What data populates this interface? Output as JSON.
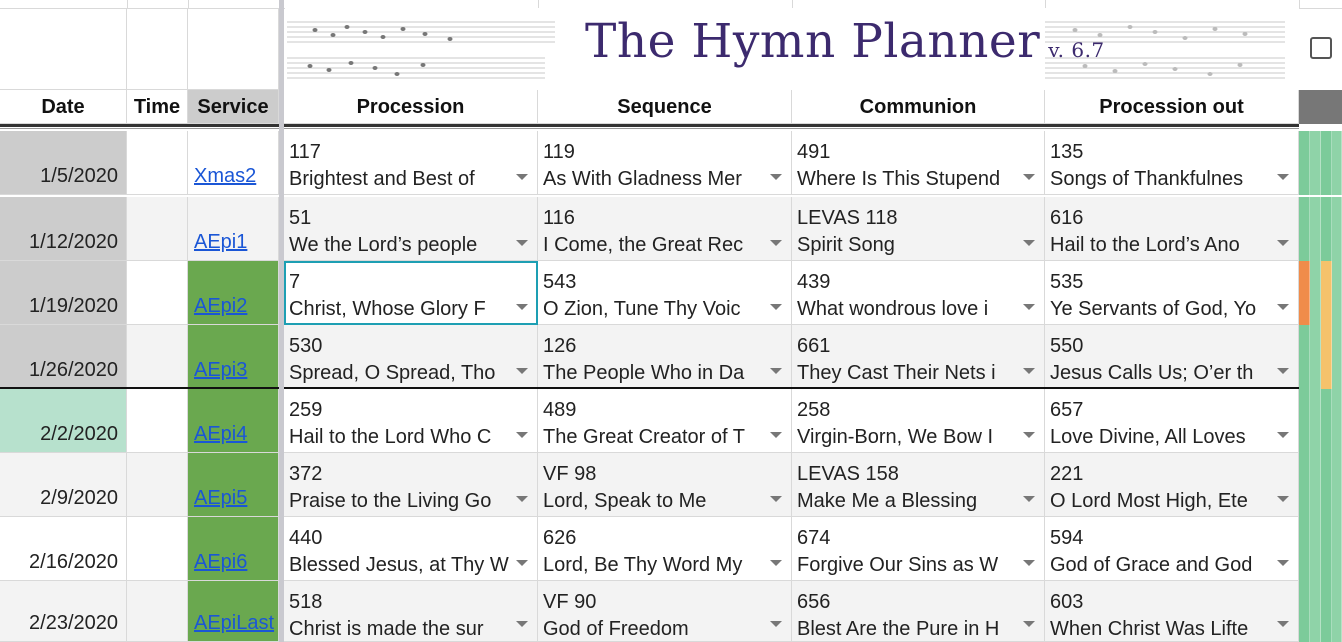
{
  "banner": {
    "title": "The Hymn Planner",
    "version": "v. 6.7"
  },
  "headers": {
    "date": "Date",
    "time": "Time",
    "service": "Service",
    "procession": "Procession",
    "sequence": "Sequence",
    "communion": "Communion",
    "procession_out": "Procession out"
  },
  "rows": [
    {
      "date": "1/5/2020",
      "time": "",
      "service": "Xmas2",
      "procession": {
        "num": "117",
        "title": "Brightest and Best of"
      },
      "sequence": {
        "num": "119",
        "title": "As With Gladness Mer"
      },
      "communion": {
        "num": "491",
        "title": "Where Is This Stupend"
      },
      "procession_out": {
        "num": "135",
        "title": "Songs of Thankfulnes"
      }
    },
    {
      "date": "1/12/2020",
      "time": "",
      "service": "AEpi1",
      "procession": {
        "num": "51",
        "title": "We the Lord’s people"
      },
      "sequence": {
        "num": "116",
        "title": "I Come, the Great Rec"
      },
      "communion": {
        "num": "LEVAS 118",
        "title": "Spirit Song"
      },
      "procession_out": {
        "num": "616",
        "title": "Hail to the Lord’s Ano"
      }
    },
    {
      "date": "1/19/2020",
      "time": "",
      "service": "AEpi2",
      "procession": {
        "num": "7",
        "title": "Christ, Whose Glory F"
      },
      "sequence": {
        "num": "543",
        "title": "O Zion, Tune Thy Voic"
      },
      "communion": {
        "num": "439",
        "title": "What wondrous love i"
      },
      "procession_out": {
        "num": "535",
        "title": "Ye Servants of God, Yo"
      }
    },
    {
      "date": "1/26/2020",
      "time": "",
      "service": "AEpi3",
      "procession": {
        "num": "530",
        "title": "Spread, O Spread, Tho"
      },
      "sequence": {
        "num": "126",
        "title": "The People Who in Da"
      },
      "communion": {
        "num": "661",
        "title": "They Cast Their Nets i"
      },
      "procession_out": {
        "num": "550",
        "title": "Jesus Calls Us; O’er th"
      }
    },
    {
      "date": "2/2/2020",
      "time": "",
      "service": "AEpi4",
      "procession": {
        "num": "259",
        "title": "Hail to the Lord Who C"
      },
      "sequence": {
        "num": "489",
        "title": "The Great Creator of T"
      },
      "communion": {
        "num": "258",
        "title": "Virgin-Born, We Bow I"
      },
      "procession_out": {
        "num": "657",
        "title": "Love Divine, All Loves"
      }
    },
    {
      "date": "2/9/2020",
      "time": "",
      "service": "AEpi5",
      "procession": {
        "num": "372",
        "title": "Praise to the Living Go"
      },
      "sequence": {
        "num": "VF 98",
        "title": "Lord, Speak to Me"
      },
      "communion": {
        "num": "LEVAS 158",
        "title": "Make Me a Blessing"
      },
      "procession_out": {
        "num": "221",
        "title": "O Lord Most High, Ete"
      }
    },
    {
      "date": "2/16/2020",
      "time": "",
      "service": "AEpi6",
      "procession": {
        "num": "440",
        "title": "Blessed Jesus, at Thy W"
      },
      "sequence": {
        "num": "626",
        "title": "Lord, Be Thy Word My"
      },
      "communion": {
        "num": "674",
        "title": "Forgive Our Sins as W"
      },
      "procession_out": {
        "num": "594",
        "title": "God of Grace and God"
      }
    },
    {
      "date": "2/23/2020",
      "time": "",
      "service": "AEpiLast",
      "procession": {
        "num": "518",
        "title": "Christ is made the sur"
      },
      "sequence": {
        "num": "VF 90",
        "title": "God of Freedom"
      },
      "communion": {
        "num": "656",
        "title": "Blest Are the Pure in H"
      },
      "procession_out": {
        "num": "603",
        "title": "When Christ Was Lifte"
      }
    }
  ],
  "colors": {
    "date_past_bg": "#cccccc",
    "date_current_bg": "#b7e1cd",
    "service_green_bg": "#6aa84f",
    "link_color": "#1a56d6",
    "selection_border": "#1d9fb3",
    "banner_title_color": "#3c2a6e"
  }
}
